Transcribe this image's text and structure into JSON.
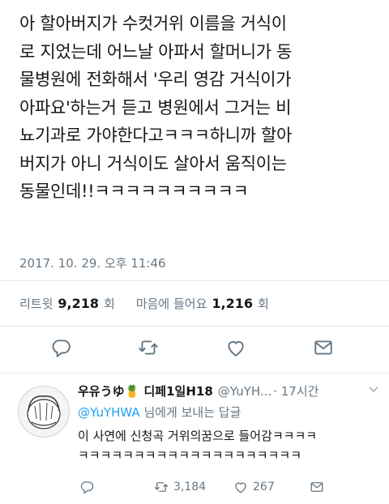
{
  "tweet": {
    "text": "아 할아버지가 수컷거위 이름을 거식이\n로 지었는데 어느날 아파서 할머니가 동\n물병원에 전화해서 '우리 영감 거식이가\n아파요'하는거 듣고 병원에서 그거는 비\n뇨기과로 가야한다고ㅋㅋㅋ하니까 할아\n버지가 아니 거식이도 살아서 움직이는\n동물인데!!ㅋㅋㅋㅋㅋㅋㅋㅋㅋㅋ",
    "timestamp": "2017. 10. 29. 오후 11:46"
  },
  "stats": {
    "retweets_label": "리트윗",
    "retweets_count": "9,218",
    "retweets_unit": "회",
    "likes_label": "마음에 들어요",
    "likes_count": "1,216",
    "likes_unit": "회"
  },
  "actions": {
    "icons": [
      "reply-icon",
      "retweet-icon",
      "like-icon",
      "share-icon"
    ],
    "color": "#657786"
  },
  "reply": {
    "name": "우유うゆ🍍 디페1일H18",
    "handle": "@YuYH...",
    "time": "· 17시간",
    "reply_to_mention": "@YuYHWA",
    "reply_to_suffix": " 님에게 보내는 답글",
    "text": "이 사연에 신청곡 거위의꿈으로 들어감ㅋㅋㅋㅋ\nㅋㅋㅋㅋㅋㅋㅋㅋㅋㅋㅋㅋㅋㅋㅋㅋㅋㅋㅋㅋ",
    "retweet_count": "3,184",
    "like_count": "267"
  },
  "colors": {
    "text": "#14171a",
    "secondary": "#657786",
    "link": "#1da1f2",
    "divider": "#e1e8ed"
  }
}
